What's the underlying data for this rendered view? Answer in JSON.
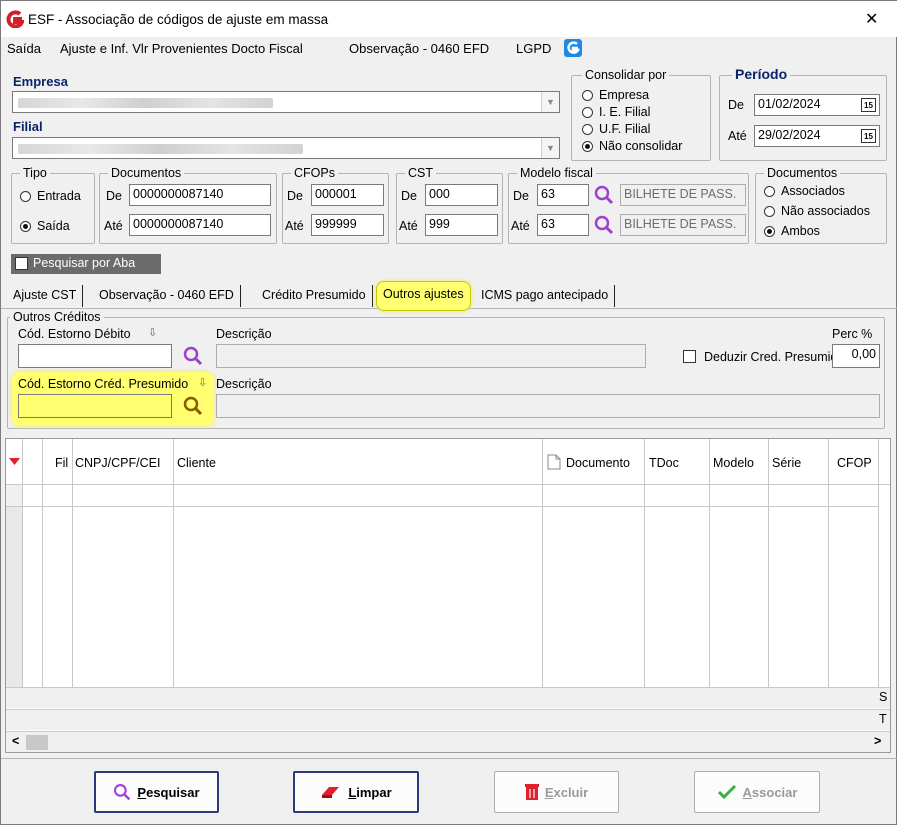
{
  "window": {
    "title": "ESF - Associação de códigos de ajuste em massa",
    "close_glyph": "✕"
  },
  "menu": [
    "Saída",
    "Ajuste e Inf. Vlr Provenientes Docto Fiscal",
    "Observação - 0460 EFD",
    "LGPD"
  ],
  "empresa": {
    "label": "Empresa"
  },
  "filial": {
    "label": "Filial"
  },
  "consolidar": {
    "legend": "Consolidar por",
    "options": [
      "Empresa",
      "I. E. Filial",
      "U.F. Filial",
      "Não consolidar"
    ],
    "selected": 3
  },
  "periodo": {
    "legend": "Período",
    "de_label": "De",
    "de_value": "01/02/2024",
    "ate_label": "Até",
    "ate_value": "29/02/2024",
    "cal_glyph": "15"
  },
  "tipo": {
    "legend": "Tipo",
    "options": [
      "Entrada",
      "Saída"
    ],
    "selected": 1
  },
  "documentos_range": {
    "legend": "Documentos",
    "de_label": "De",
    "de_value": "0000000087140",
    "ate_label": "Até",
    "ate_value": "0000000087140"
  },
  "cfops": {
    "legend": "CFOPs",
    "de_label": "De",
    "de_value": "000001",
    "ate_label": "Até",
    "ate_value": "999999"
  },
  "cst": {
    "legend": "CST",
    "de_label": "De",
    "de_value": "000",
    "ate_label": "Até",
    "ate_value": "999"
  },
  "modelo": {
    "legend": "Modelo fiscal",
    "de_label": "De",
    "de_value": "63",
    "de_desc": "BILHETE DE PASS.",
    "ate_label": "Até",
    "ate_value": "63",
    "ate_desc": "BILHETE DE PASS."
  },
  "documentos_filter": {
    "legend": "Documentos",
    "options": [
      "Associados",
      "Não associados",
      "Ambos"
    ],
    "selected": 2
  },
  "pesquisar_aba": {
    "label": "Pesquisar por Aba"
  },
  "tabs": [
    "Ajuste CST",
    "Observação - 0460 EFD",
    "Crédito Presumido",
    "Outros ajustes",
    "ICMS pago antecipado"
  ],
  "outros": {
    "legend": "Outros Créditos",
    "estorno_debito_label": "Cód. Estorno Débito",
    "descricao_label": "Descrição",
    "perc_label": "Perc %",
    "perc_value": "0,00",
    "deduzir_label": "Deduzir Cred. Presumido",
    "estorno_cred_label": "Cód. Estorno Créd. Presumido",
    "descricao2_label": "Descrição",
    "sort_glyph": "⇩"
  },
  "grid": {
    "columns": [
      "Fil",
      "CNPJ/CPF/CEI",
      "Cliente",
      "Documento",
      "TDoc",
      "Modelo",
      "Série",
      "CFOP"
    ],
    "footer_s": "S",
    "footer_t": "T",
    "scroll_left": "<",
    "scroll_right": ">"
  },
  "buttons": {
    "pesquisar_rest": "esquisar",
    "pesquisar_key": "P",
    "limpar_rest": "impar",
    "limpar_key": "L",
    "excluir_rest": "xcluir",
    "excluir_key": "E",
    "associar_rest": "ssociar",
    "associar_key": "A"
  },
  "colors": {
    "highlight": "#ffff70",
    "brand_red": "#d0202a",
    "navy": "#0a246a",
    "search_icon": "#a040d0",
    "lgpd_blue": "#1e88e5"
  }
}
